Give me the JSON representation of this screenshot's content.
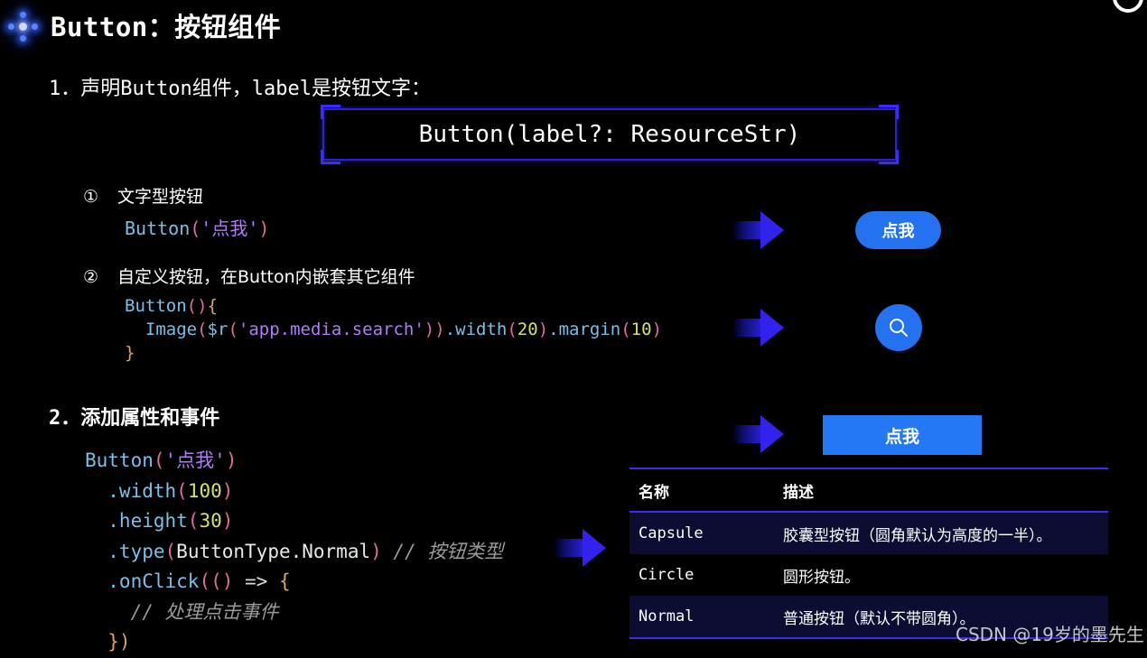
{
  "header": {
    "title": "Button：按钮组件",
    "logo_icon": "diamond-compass-logo",
    "corner_icon": "circle-outline-icon"
  },
  "sections": {
    "step1": "1．声明Button组件，label是按钮文字：",
    "step2": "2．添加属性和事件"
  },
  "signature": {
    "text": "Button(label?: ResourceStr)"
  },
  "bullets": [
    {
      "marker": "①",
      "label": "文字型按钮"
    },
    {
      "marker": "②",
      "label": "自定义按钮，在Button内嵌套其它组件"
    }
  ],
  "code_text": {
    "a_fn": "Button",
    "a_open": "(",
    "a_str": "'点我'",
    "a_close": ")",
    "b_l1_fn": "Button",
    "b_l1_parens": "()",
    "b_l1_brace": "{",
    "b_l2_indent": "  ",
    "b_l2_fn": "Image",
    "b_l2_open": "(",
    "b_l2_r": "$r",
    "b_l2_open2": "(",
    "b_l2_str": "'app.media.search'",
    "b_l2_close2": ")",
    "b_l2_close": ")",
    "b_l2_dotwidth": ".width",
    "b_l2_wopen": "(",
    "b_l2_wnum": "20",
    "b_l2_wclose": ")",
    "b_l2_dotmargin": ".margin",
    "b_l2_mopen": "(",
    "b_l2_mnum": "10",
    "b_l2_mclose": ")",
    "b_l3_brace": "}",
    "c_l1_fn": "Button",
    "c_l1_open": "(",
    "c_l1_str": "'点我'",
    "c_l1_close": ")",
    "c_l2_dot": "  .width",
    "c_l2_open": "(",
    "c_l2_num": "100",
    "c_l2_close": ")",
    "c_l3_dot": "  .height",
    "c_l3_open": "(",
    "c_l3_num": "30",
    "c_l3_close": ")",
    "c_l4_dot": "  .type",
    "c_l4_open": "(",
    "c_l4_arg": "ButtonType.Normal",
    "c_l4_close": ")",
    "c_l4_comment": " // 按钮类型",
    "c_l5_dot": "  .onClick",
    "c_l5_open": "(()",
    "c_l5_arrow": " => ",
    "c_l5_brace": "{",
    "c_l6_comment": "    // 处理点击事件",
    "c_l7_end": "  })"
  },
  "demo_buttons": {
    "capsule_label": "点我",
    "circle_icon": "search-icon",
    "normal_label": "点我"
  },
  "table": {
    "headers": [
      "名称",
      "描述"
    ],
    "rows": [
      {
        "name": "Capsule",
        "desc": "胶囊型按钮（圆角默认为高度的一半）。"
      },
      {
        "name": "Circle",
        "desc": "圆形按钮。"
      },
      {
        "name": "Normal",
        "desc": "普通按钮（默认不带圆角）。"
      }
    ]
  },
  "watermark": "CSDN @19岁的墨先生",
  "colors": {
    "accent_blue": "#2472f0",
    "border_purple": "#3a2bff",
    "row_alt": "#0d0d33",
    "background": "#000000"
  }
}
